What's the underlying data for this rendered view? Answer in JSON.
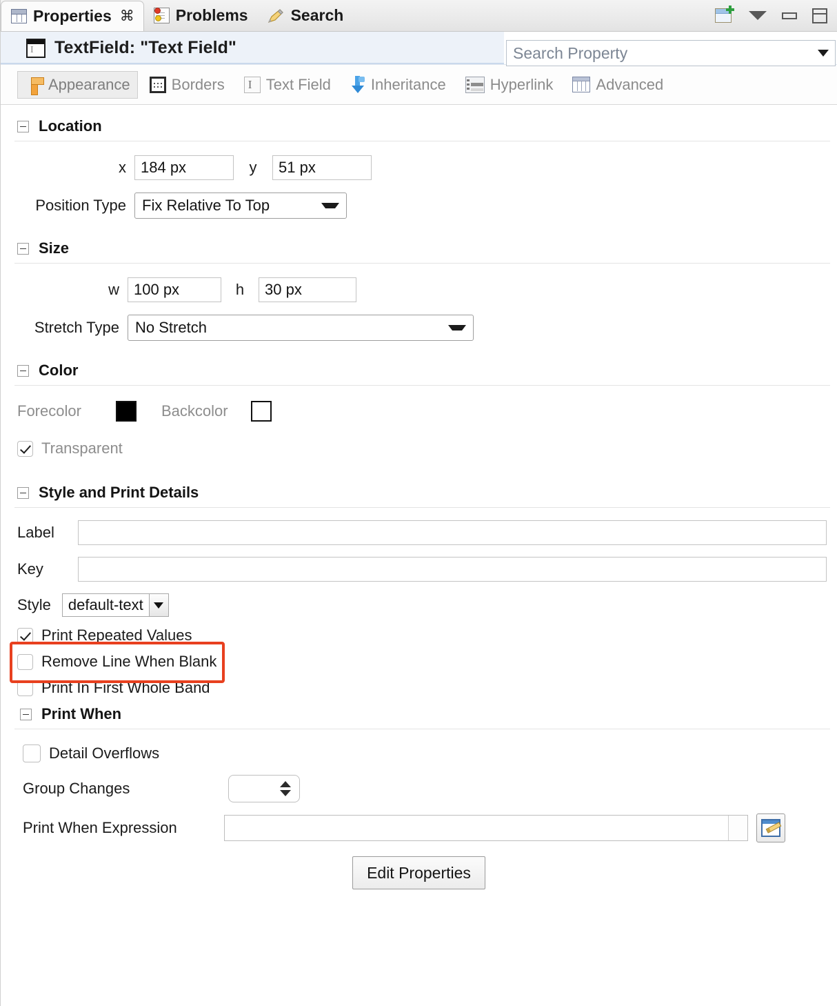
{
  "tabbar": {
    "tabs": [
      {
        "label": "Properties",
        "icon": "table-icon",
        "active": true,
        "close_glyph": "⌘"
      },
      {
        "label": "Problems",
        "icon": "problems-icon",
        "active": false
      },
      {
        "label": "Search",
        "icon": "pen-icon",
        "active": false
      }
    ],
    "tools": [
      {
        "name": "new-view-icon"
      },
      {
        "name": "view-menu-caret-icon"
      },
      {
        "name": "minimize-icon"
      },
      {
        "name": "maximize-icon"
      }
    ]
  },
  "header": {
    "title": "TextField: \"Text Field\"",
    "icon": "textfield-icon"
  },
  "search": {
    "placeholder": "Search Property",
    "value": ""
  },
  "subtabs": [
    {
      "label": "Appearance",
      "icon": "ruler-icon",
      "active": true
    },
    {
      "label": "Borders",
      "icon": "borders-icon",
      "active": false
    },
    {
      "label": "Text Field",
      "icon": "textfield-small-icon",
      "active": false
    },
    {
      "label": "Inheritance",
      "icon": "inheritance-arrow-icon",
      "active": false
    },
    {
      "label": "Hyperlink",
      "icon": "hyperlink-icon",
      "active": false
    },
    {
      "label": "Advanced",
      "icon": "advanced-table-icon",
      "active": false
    }
  ],
  "location": {
    "section_title": "Location",
    "x_label": "x",
    "x_value": "184 px",
    "y_label": "y",
    "y_value": "51 px",
    "position_type_label": "Position Type",
    "position_type_value": "Fix Relative To Top"
  },
  "size": {
    "section_title": "Size",
    "w_label": "w",
    "w_value": "100 px",
    "h_label": "h",
    "h_value": "30 px",
    "stretch_type_label": "Stretch Type",
    "stretch_type_value": "No Stretch"
  },
  "color": {
    "section_title": "Color",
    "forecolor_label": "Forecolor",
    "forecolor_value": "#000000",
    "backcolor_label": "Backcolor",
    "backcolor_value": "#ffffff",
    "transparent_label": "Transparent",
    "transparent_checked": true
  },
  "style_print": {
    "section_title": "Style and Print Details",
    "label_label": "Label",
    "label_value": "",
    "key_label": "Key",
    "key_value": "",
    "style_label": "Style",
    "style_value": "default-text",
    "highlight_color": "#e8401f",
    "checkboxes": [
      {
        "label": "Print Repeated Values",
        "checked": true
      },
      {
        "label": "Remove Line When Blank",
        "checked": false
      },
      {
        "label": "Print In First Whole Band",
        "checked": false
      }
    ]
  },
  "print_when": {
    "section_title": "Print When",
    "detail_overflows_label": "Detail Overflows",
    "detail_overflows_checked": false,
    "group_changes_label": "Group Changes",
    "group_changes_value": "",
    "expression_label": "Print When Expression",
    "expression_value": "",
    "expression_edit_icon": "edit-expression-icon"
  },
  "footer": {
    "edit_properties_label": "Edit Properties"
  }
}
